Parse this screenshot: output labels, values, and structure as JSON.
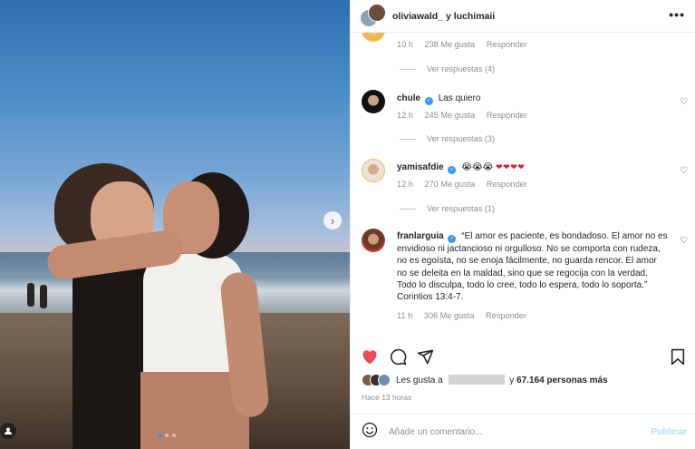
{
  "post": {
    "header_title": "oliviawald_ y luchimaii",
    "more_label": "•••"
  },
  "comments": [
    {
      "user": "",
      "text": "",
      "time": "10 h",
      "likes": "238 Me gusta",
      "reply": "Responder",
      "view_replies": "Ver respuestas (4)"
    },
    {
      "user": "chule",
      "text": "Las quiero",
      "time": "12 h",
      "likes": "245 Me gusta",
      "reply": "Responder",
      "view_replies": "Ver respuestas (3)"
    },
    {
      "user": "yamisafdie",
      "emoji_faces": "😭😭😭",
      "emoji_hearts": "❤❤❤❤",
      "time": "12 h",
      "likes": "270 Me gusta",
      "reply": "Responder",
      "view_replies": "Ver respuestas (1)"
    },
    {
      "user": "franlarguia",
      "text": "“El amor es paciente, es bondadoso. El amor no es envidioso ni jactancioso ni orgulloso. No se comporta con rudeza, no es egoísta, no se enoja fácilmente, no guarda rencor. El amor no se deleita en la maldad, sino que se regocija con la verdad. Todo lo disculpa, todo lo cree, todo lo espera, todo lo soporta.” Corintios 13:4-7.",
      "time": "11 h",
      "likes": "306 Me gusta",
      "reply": "Responder"
    }
  ],
  "likes_summary": {
    "prefix": "Les gusta a",
    "connector": "y",
    "count": "67.164 personas más"
  },
  "posted_time": "Hace 13 horas",
  "comment_box": {
    "placeholder": "Añade un comentario...",
    "post_label": "Publicar"
  },
  "icons": {
    "heart": "heart-filled-red",
    "comment": "speech-bubble",
    "share": "paper-plane",
    "save": "bookmark",
    "emoji": "smiley"
  },
  "colors": {
    "like_red": "#ed4956",
    "verified_blue": "#3897f0",
    "post_disabled": "#b2dffc"
  }
}
